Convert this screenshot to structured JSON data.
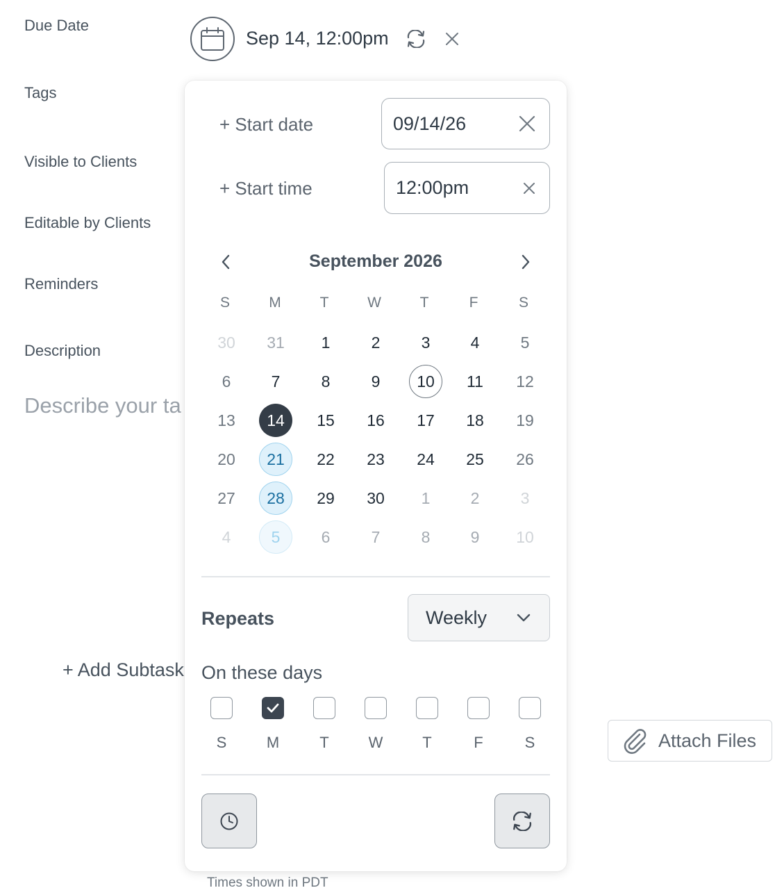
{
  "form": {
    "due_date_label": "Due Date",
    "tags_label": "Tags",
    "visible_label": "Visible to Clients",
    "editable_label": "Editable by Clients",
    "reminders_label": "Reminders",
    "description_label": "Description",
    "description_placeholder": "Describe your ta",
    "add_subtask": "+ Add Subtask",
    "times_note": "Times shown in PDT"
  },
  "due_date": {
    "value": "Sep 14, 12:00pm",
    "icons": {
      "calendar": "calendar-icon",
      "repeat": "repeat-icon",
      "clear": "close-icon"
    }
  },
  "attach": {
    "label": "Attach Files",
    "icon": "paperclip-icon"
  },
  "picker": {
    "start_date_link": "+ Start date",
    "start_date_value": "09/14/26",
    "start_time_link": "+ Start time",
    "start_time_value": "12:00pm",
    "month_title": "September 2026",
    "weekday_headers": [
      "S",
      "M",
      "T",
      "W",
      "T",
      "F",
      "S"
    ],
    "weeks": [
      [
        "30",
        "31",
        "1",
        "2",
        "3",
        "4",
        "5"
      ],
      [
        "6",
        "7",
        "8",
        "9",
        "10",
        "11",
        "12"
      ],
      [
        "13",
        "14",
        "15",
        "16",
        "17",
        "18",
        "19"
      ],
      [
        "20",
        "21",
        "22",
        "23",
        "24",
        "25",
        "26"
      ],
      [
        "27",
        "28",
        "29",
        "30",
        "1",
        "2",
        "3"
      ],
      [
        "4",
        "5",
        "6",
        "7",
        "8",
        "9",
        "10"
      ]
    ],
    "repeats_label": "Repeats",
    "repeats_value": "Weekly",
    "on_days_label": "On these days",
    "day_checks": [
      {
        "label": "S",
        "checked": false
      },
      {
        "label": "M",
        "checked": true
      },
      {
        "label": "T",
        "checked": false
      },
      {
        "label": "W",
        "checked": false
      },
      {
        "label": "T",
        "checked": false
      },
      {
        "label": "F",
        "checked": false
      },
      {
        "label": "S",
        "checked": false
      }
    ]
  },
  "colors": {
    "selected_day": "#343d47",
    "recurrence_fill": "#dff1fb",
    "recurrence_text": "#1a6fa0",
    "text_primary": "#2f3a45",
    "text_muted": "#6f7881"
  }
}
